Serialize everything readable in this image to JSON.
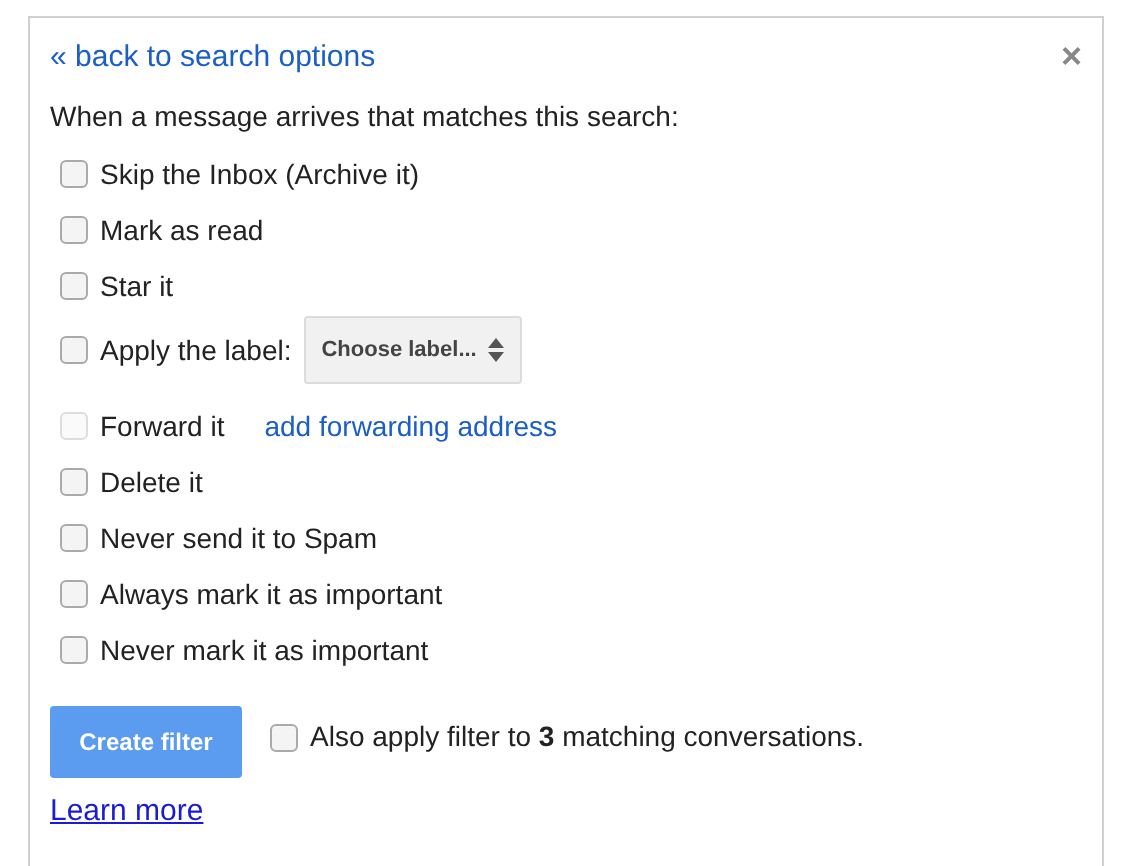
{
  "back_link": "« back to search options",
  "close": "×",
  "heading": "When a message arrives that matches this search:",
  "options": [
    {
      "kind": "plain",
      "label": "Skip the Inbox (Archive it)",
      "checked": false,
      "disabled": false
    },
    {
      "kind": "plain",
      "label": "Mark as read",
      "checked": false,
      "disabled": false
    },
    {
      "kind": "plain",
      "label": "Star it",
      "checked": false,
      "disabled": false
    },
    {
      "kind": "select",
      "label": "Apply the label:",
      "checked": false,
      "disabled": false,
      "select": "Choose label..."
    },
    {
      "kind": "link",
      "label": "Forward it",
      "checked": false,
      "disabled": true,
      "link": "add forwarding address"
    },
    {
      "kind": "plain",
      "label": "Delete it",
      "checked": false,
      "disabled": false
    },
    {
      "kind": "plain",
      "label": "Never send it to Spam",
      "checked": false,
      "disabled": false
    },
    {
      "kind": "plain",
      "label": "Always mark it as important",
      "checked": false,
      "disabled": false
    },
    {
      "kind": "plain",
      "label": "Never mark it as important",
      "checked": false,
      "disabled": false
    }
  ],
  "create_button": "Create filter",
  "also_apply": {
    "label": "Also apply filter to **3** matching conversations.",
    "checked": false
  },
  "learn_more": "Learn more"
}
